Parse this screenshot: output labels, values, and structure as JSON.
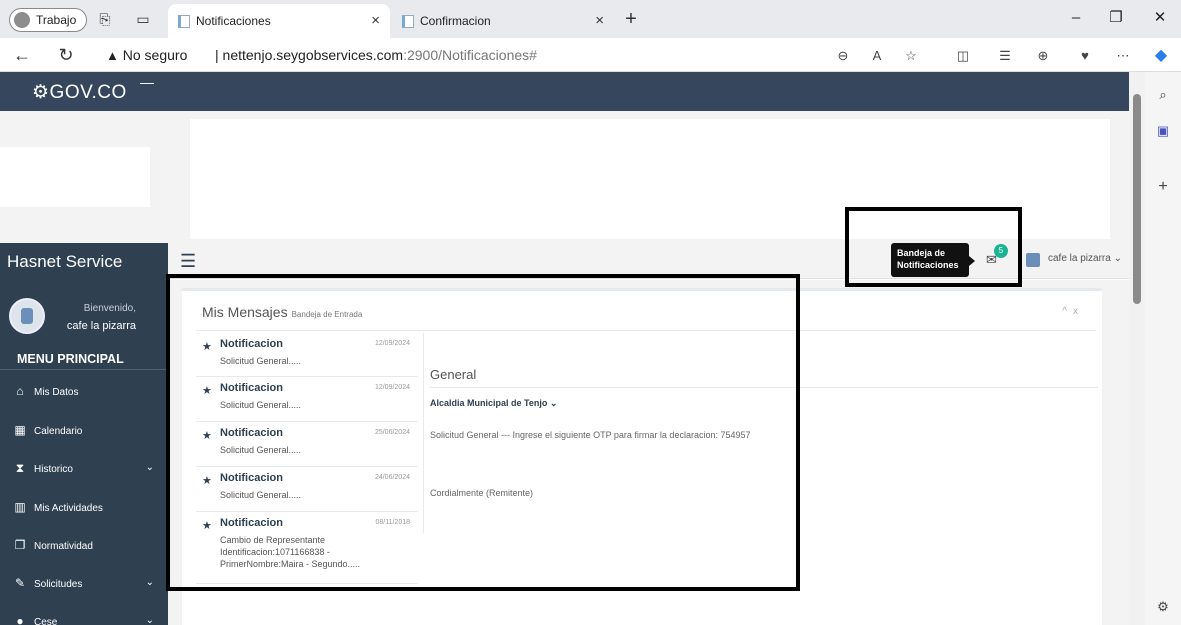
{
  "browser": {
    "profile_label": "Trabajo",
    "tabs": [
      {
        "title": "Notificaciones",
        "close": "×"
      },
      {
        "title": "Confirmacion",
        "close": "×"
      }
    ],
    "new_tab": "+",
    "url_warning": "No seguro",
    "url_host": "nettenjo.seygobservices.com",
    "url_rest": ":2900/Notificaciones#"
  },
  "page": {
    "gov_logo": "GOV.CO",
    "sidebar": {
      "brand": "Hasnet Service",
      "welcome": "Bienvenido,",
      "user": "cafe la pizarra",
      "menu_title": "MENU PRINCIPAL",
      "items": [
        {
          "label": "Mis Datos",
          "icon": "home-icon",
          "glyph": "⌂"
        },
        {
          "label": "Calendario",
          "icon": "calendar-icon",
          "glyph": "▦"
        },
        {
          "label": "Historico",
          "icon": "hourglass-icon",
          "glyph": "⧗",
          "caret": "⌄"
        },
        {
          "label": "Mis Actividades",
          "icon": "bar-chart-icon",
          "glyph": "▥"
        },
        {
          "label": "Normatividad",
          "icon": "copy-icon",
          "glyph": "❐"
        },
        {
          "label": "Solicitudes",
          "icon": "edit-icon",
          "glyph": "✎",
          "caret": "⌄"
        },
        {
          "label": "Cese",
          "icon": "info-icon",
          "glyph": "●",
          "caret": "⌄"
        }
      ]
    },
    "topnav": {
      "tooltip_line1": "Bandeja de",
      "tooltip_line2": "Notificaciones",
      "badge": "5",
      "user": "cafe la pizarra ⌄"
    },
    "mailbox": {
      "title": "Mis Mensajes",
      "subtitle": "Bandeja de Entrada",
      "messages": [
        {
          "title": "Notificacion",
          "date": "12/09/2024",
          "snippet": "Solicitud General....."
        },
        {
          "title": "Notificacion",
          "date": "12/09/2024",
          "snippet": "Solicitud General....."
        },
        {
          "title": "Notificacion",
          "date": "25/06/2024",
          "snippet": "Solicitud General....."
        },
        {
          "title": "Notificacion",
          "date": "24/06/2024",
          "snippet": "Solicitud General....."
        },
        {
          "title": "Notificacion",
          "date": "08/11/2018",
          "snippet": "Cambio de Representante Identificacion:1071166838 - PrimerNombre:Maira - Segundo....."
        }
      ],
      "detail": {
        "heading": "General",
        "sender": "Alcaldia Municipal de Tenjo ⌄",
        "body": "Solicitud General --- Ingrese el siguiente OTP para firmar la declaracion: 754957",
        "signature": "Cordialmente (Remitente)"
      }
    }
  }
}
